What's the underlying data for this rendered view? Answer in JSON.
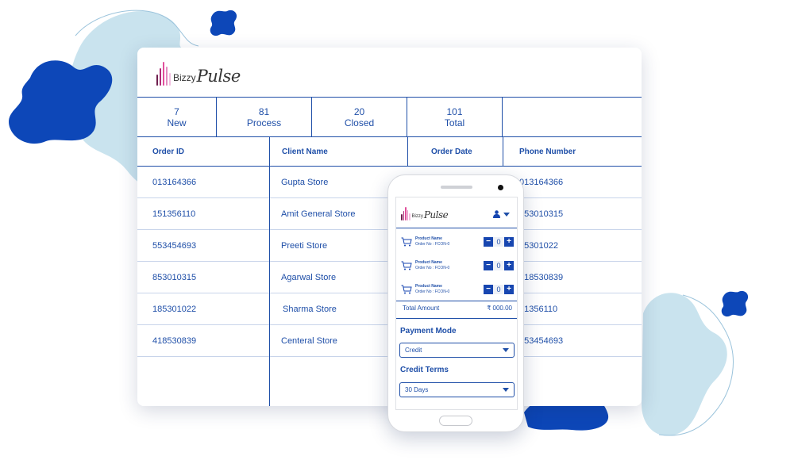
{
  "brand": {
    "name_prefix": "Bizzy",
    "name_main": "Pulse",
    "bar_colors": [
      "#6e1f4e",
      "#b22b79",
      "#e14f9c",
      "#e589c0",
      "#f2bfe0"
    ]
  },
  "colors": {
    "accent": "#1f4fa8",
    "blob_dark": "#0d47b8",
    "blob_light": "#c9e3ee"
  },
  "stats": [
    {
      "count": "7",
      "label": "New"
    },
    {
      "count": "81",
      "label": "Process"
    },
    {
      "count": "20",
      "label": "Closed"
    },
    {
      "count": "101",
      "label": "Total"
    },
    {
      "count": "",
      "label": ""
    }
  ],
  "table": {
    "headers": [
      "Order ID",
      "Client Name",
      "Order Date",
      "Phone Number"
    ],
    "rows": [
      {
        "order_id": "013164366",
        "client": "Gupta Store",
        "phone": "013164366"
      },
      {
        "order_id": "151356110",
        "client": "Amit General Store",
        "phone": "553010315"
      },
      {
        "order_id": "553454693",
        "client": "Preeti Store",
        "phone": "85301022"
      },
      {
        "order_id": "853010315",
        "client": "Agarwal Store",
        "phone": "418530839"
      },
      {
        "order_id": "185301022",
        "client": "Sharma Store",
        "phone": "51356110"
      },
      {
        "order_id": "418530839",
        "client": "Centeral Store",
        "phone": "553454693"
      }
    ]
  },
  "phone": {
    "user_icon": "user-icon",
    "items": [
      {
        "product": "Product Name",
        "order_no": "Order No : FCON-0",
        "qty": "0"
      },
      {
        "product": "Product Name",
        "order_no": "Order No : FCON-0",
        "qty": "0"
      },
      {
        "product": "Product Name",
        "order_no": "Order No : FCON-0",
        "qty": "0"
      }
    ],
    "minus": "−",
    "plus": "+",
    "total_label": "Total Amount",
    "total_value": "₹ 000.00",
    "payment_label": "Payment Mode",
    "payment_value": "Credit",
    "credit_label": "Credit Terms",
    "credit_value": "30 Days"
  }
}
